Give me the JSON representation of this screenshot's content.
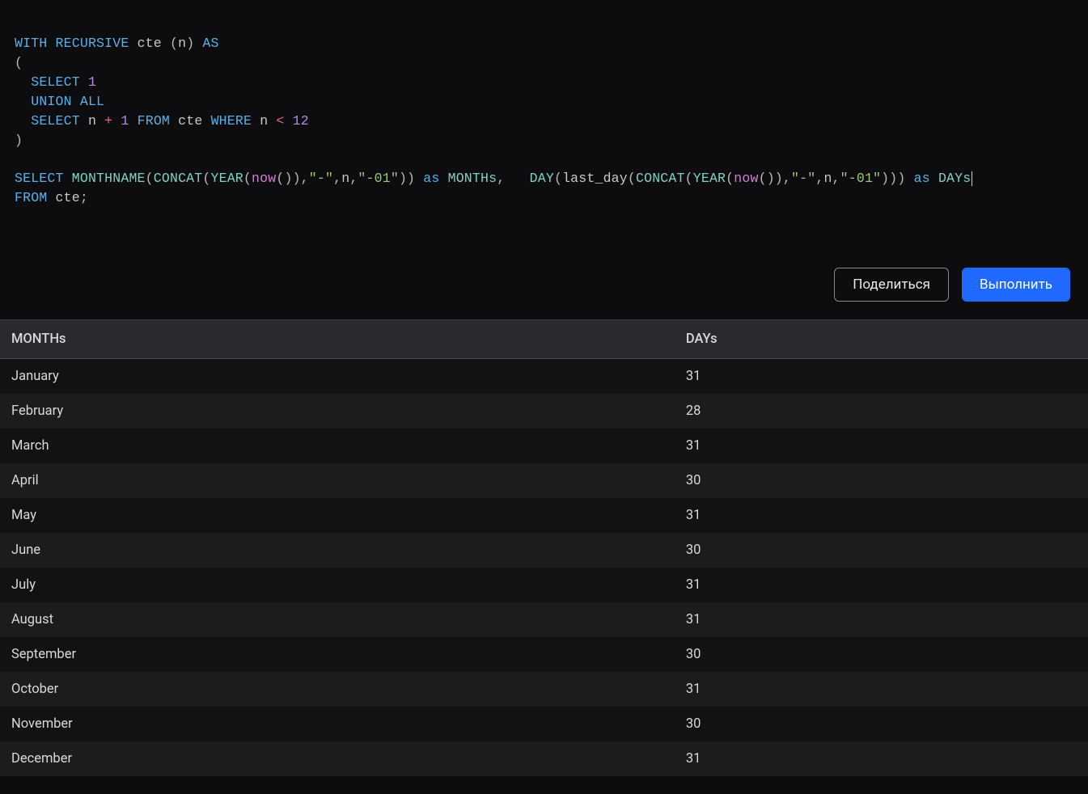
{
  "editor": {
    "line1": {
      "with": "WITH",
      "recursive": "RECURSIVE",
      "cte": "cte",
      "lp": "(",
      "n": "n",
      "rp": ")",
      "as": "AS"
    },
    "line2": {
      "lp": "("
    },
    "line3": {
      "select": "SELECT",
      "one": "1"
    },
    "line4": {
      "union": "UNION",
      "all": "ALL"
    },
    "line5": {
      "select": "SELECT",
      "n": "n",
      "plus": "+",
      "one": "1",
      "from": "FROM",
      "cte": "cte",
      "where": "WHERE",
      "n2": "n",
      "lt": "<",
      "twelve": "12"
    },
    "line6": {
      "rp": ")"
    },
    "line8": {
      "select": "SELECT",
      "monthname": "MONTHNAME",
      "lp1": "(",
      "concat1": "CONCAT",
      "lp2": "(",
      "year1": "YEAR",
      "lp3": "(",
      "now1": "now",
      "lp4": "(",
      "rp4": ")",
      "rp3": ")",
      "comma1": ",",
      "dash1": "\"-\"",
      "comma2": ",",
      "n1": "n",
      "comma3": ",",
      "d01a": "\"-01\"",
      "rp2": ")",
      "rp1": ")",
      "as1": "as",
      "months_alias": "MONTHs",
      "comma4": ",",
      "day": "DAY",
      "lp5": "(",
      "lastday": "last_day",
      "lp6": "(",
      "concat2": "CONCAT",
      "lp7": "(",
      "year2": "YEAR",
      "lp8": "(",
      "now2": "now",
      "lp9": "(",
      "rp9": ")",
      "rp8": ")",
      "comma5": ",",
      "dash2": "\"-\"",
      "comma6": ",",
      "n2": "n",
      "comma7": ",",
      "d01b": "\"-01\"",
      "rp7": ")",
      "rp6": ")",
      "rp5": ")",
      "as2": "as",
      "days_alias": "DAYs"
    },
    "line9": {
      "from": "FROM",
      "cte": "cte",
      "semi": ";"
    }
  },
  "toolbar": {
    "share_label": "Поделиться",
    "run_label": "Выполнить"
  },
  "table": {
    "headers": {
      "months": "MONTHs",
      "days": "DAYs"
    },
    "rows": [
      {
        "month": "January",
        "days": "31"
      },
      {
        "month": "February",
        "days": "28"
      },
      {
        "month": "March",
        "days": "31"
      },
      {
        "month": "April",
        "days": "30"
      },
      {
        "month": "May",
        "days": "31"
      },
      {
        "month": "June",
        "days": "30"
      },
      {
        "month": "July",
        "days": "31"
      },
      {
        "month": "August",
        "days": "31"
      },
      {
        "month": "September",
        "days": "30"
      },
      {
        "month": "October",
        "days": "31"
      },
      {
        "month": "November",
        "days": "30"
      },
      {
        "month": "December",
        "days": "31"
      }
    ]
  }
}
